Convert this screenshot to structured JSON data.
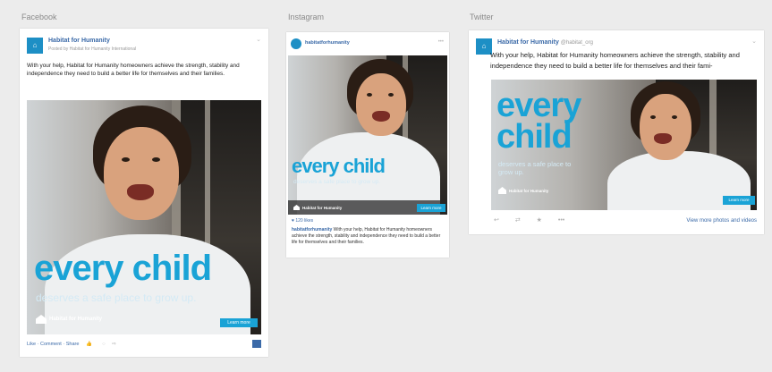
{
  "labels": {
    "facebook": "Facebook",
    "instagram": "Instagram",
    "twitter": "Twitter"
  },
  "facebook": {
    "page_name": "Habitat for Humanity",
    "sponsored": "Posted by Habitat for Humanity International",
    "body": "With your help, Habitat for Humanity homeowners achieve the strength, stability and independence they need to build a better life for themselves and their families.",
    "headline": "every child",
    "subline": "deserves a safe place to grow up.",
    "logo_text": "Habitat for Humanity",
    "cta": "Learn more",
    "actions": [
      "Like",
      "Comment",
      "Share"
    ],
    "bottom_icons": [
      "thumb-icon",
      "comment-icon",
      "share-icon"
    ]
  },
  "instagram": {
    "handle": "habitatforhumanity",
    "headline": "every child",
    "subline": "deserves a safe place to grow up.",
    "logo_text": "Habitat for Humanity",
    "cta": "Learn more",
    "likes": "120 likes",
    "caption_user": "habitatforhumanity",
    "caption": "With your help, Habitat for Humanity homeowners achieve the strength, stability and independence they need to build a better life for themselves and their families."
  },
  "twitter": {
    "name": "Habitat for Humanity",
    "handle": "@habitat_org",
    "body": "With your help, Habitat for Humanity homeowners achieve the strength, stability and independence they need to build a better life for themselves and their fami-",
    "headline_1": "every",
    "headline_2": "child",
    "subline": "deserves a safe place to grow up.",
    "logo_text": "Habitat for Humanity",
    "cta": "Learn more",
    "view_more": "View more photos and videos"
  },
  "colors": {
    "accent": "#1aa3d6",
    "link": "#3b6aa8",
    "background": "#ececec"
  }
}
